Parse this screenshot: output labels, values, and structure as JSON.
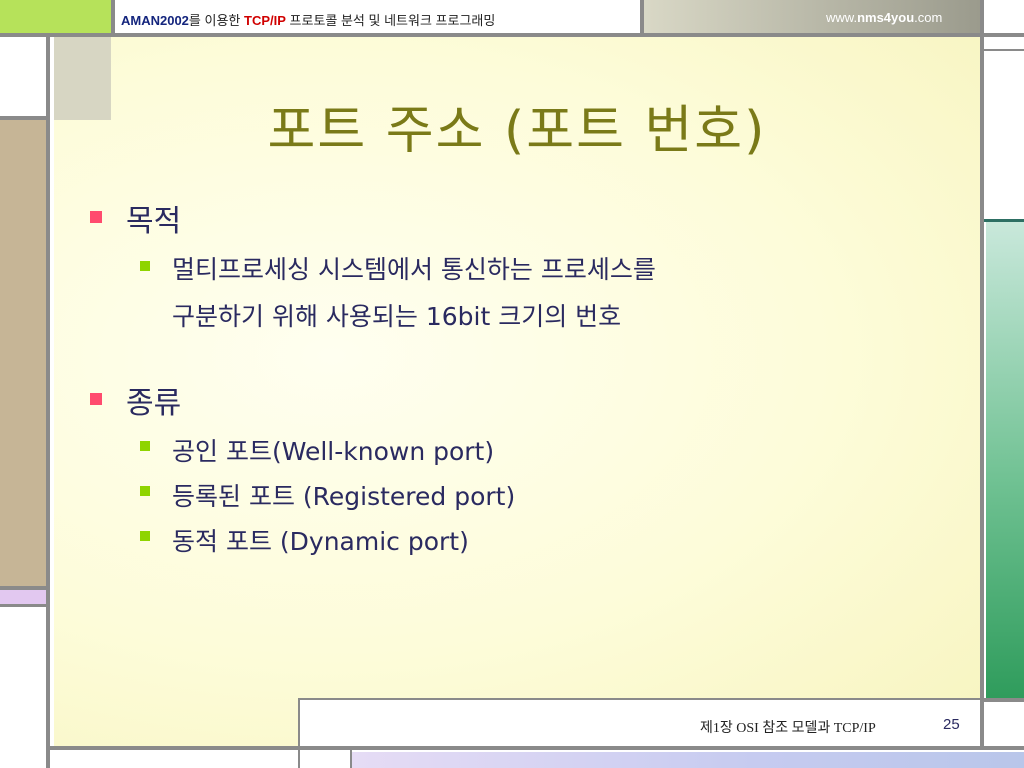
{
  "header": {
    "brand": "AMAN2002",
    "text_a": "를 이용한 ",
    "tcp": "TCP/IP",
    "text_b": " 프로토콜 분석 및 네트워크 프로그래밍"
  },
  "website": {
    "prefix": "www.",
    "bold": "nms4you",
    "suffix": ".com"
  },
  "slide": {
    "title": "포트 주소 (포트 번호)",
    "sections": [
      {
        "heading": "목적",
        "items": [
          "멀티프로세싱 시스템에서 통신하는 프로세스를",
          "구분하기 위해 사용되는 16bit 크기의 번호"
        ]
      },
      {
        "heading": "종류",
        "items": [
          "공인 포트(Well-known port)",
          "등록된 포트 (Registered port)",
          "동적 포트 (Dynamic port)"
        ]
      }
    ]
  },
  "footer": {
    "chapter": "제1장  OSI 참조 모델과 TCP/IP",
    "page_number": "25"
  },
  "colors": {
    "bullet_primary": "#ff4b6e",
    "bullet_secondary": "#8fd400",
    "title": "#7a7a18",
    "text": "#2a2a60"
  }
}
